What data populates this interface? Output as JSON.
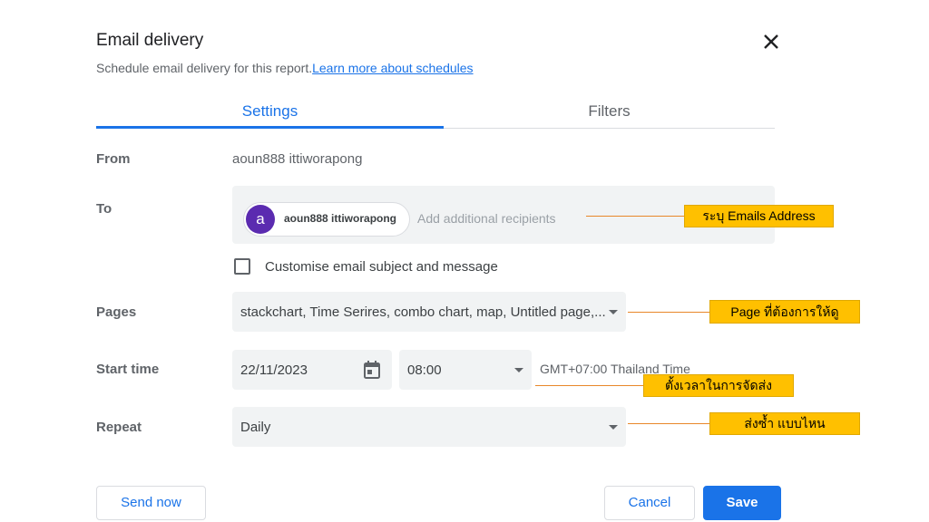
{
  "dialog": {
    "title": "Email delivery",
    "subtitle": "Schedule email delivery for this report.",
    "learn_more": "Learn more about schedules"
  },
  "tabs": [
    {
      "label": "Settings",
      "active": true
    },
    {
      "label": "Filters",
      "active": false
    }
  ],
  "form": {
    "from": {
      "label": "From",
      "value": "aoun888 ittiworapong"
    },
    "to": {
      "label": "To",
      "chip": {
        "avatar_letter": "a",
        "name": "aoun888 ittiworapong",
        "avatar_color": "#5b2bb0"
      },
      "placeholder": "Add additional recipients"
    },
    "customise": {
      "label": "Customise email subject and message",
      "checked": false
    },
    "pages": {
      "label": "Pages",
      "value": "stackchart, Time Serires, combo chart, map, Untitled page,..."
    },
    "start_time": {
      "label": "Start time",
      "date": "22/11/2023",
      "time": "08:00",
      "timezone": "GMT+07:00 Thailand Time"
    },
    "repeat": {
      "label": "Repeat",
      "value": "Daily"
    }
  },
  "buttons": {
    "send_now": "Send now",
    "cancel": "Cancel",
    "save": "Save"
  },
  "annotations": {
    "to": "ระบุ Emails Address",
    "pages": "Page ที่ต้องการให้ดู",
    "start_time": "ตั้งเวลาในการจัดส่ง",
    "repeat": "ส่งซ้ำ แบบไหน"
  },
  "colors": {
    "accent": "#1a73e8",
    "annotation": "#ffc000",
    "annotation_line": "#e8872a"
  }
}
